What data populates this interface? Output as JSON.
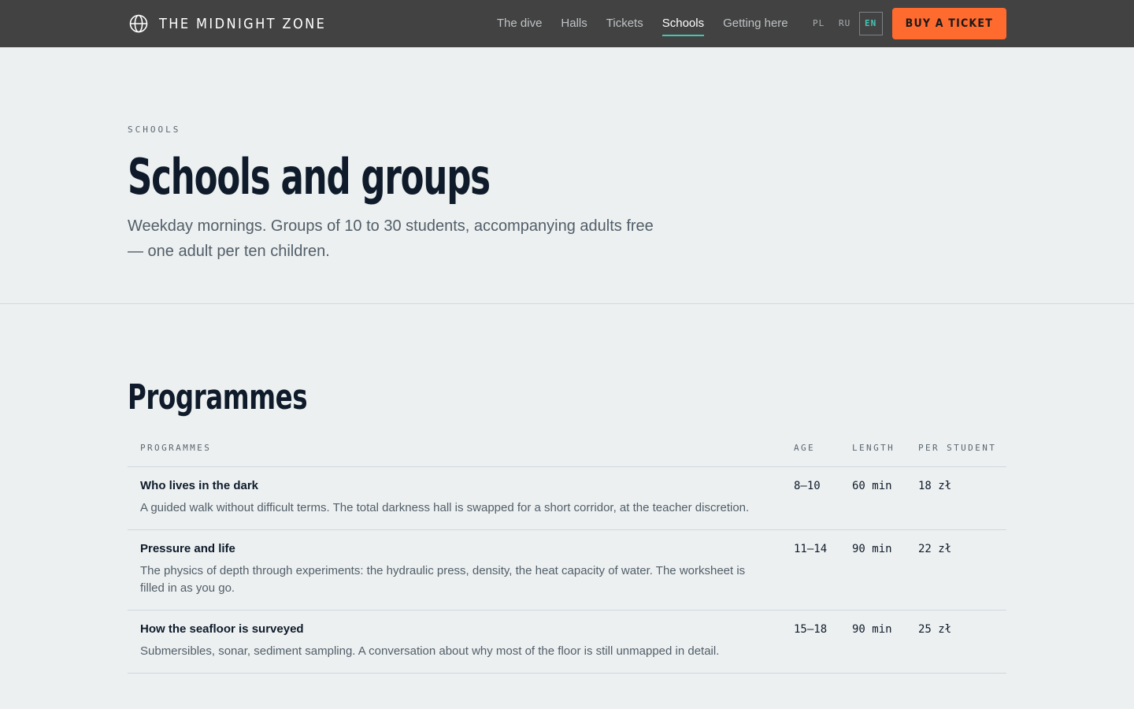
{
  "brand": {
    "name": "THE MIDNIGHT ZONE",
    "icon": "globe-icon"
  },
  "nav": {
    "items": [
      {
        "label": "The dive",
        "active": false
      },
      {
        "label": "Halls",
        "active": false
      },
      {
        "label": "Tickets",
        "active": false
      },
      {
        "label": "Schools",
        "active": true
      },
      {
        "label": "Getting here",
        "active": false
      }
    ],
    "languages": [
      {
        "code": "PL",
        "active": false
      },
      {
        "code": "RU",
        "active": false
      },
      {
        "code": "EN",
        "active": true
      }
    ],
    "cta_label": "BUY A TICKET"
  },
  "hero": {
    "eyebrow": "SCHOOLS",
    "title": "Schools and groups",
    "subtitle": "Weekday mornings. Groups of 10 to 30 students, accompanying adults free — one adult per ten children."
  },
  "programmes": {
    "title": "Programmes",
    "columns": {
      "programme": "PROGRAMMES",
      "age": "AGE",
      "length": "LENGTH",
      "price": "PER STUDENT"
    },
    "rows": [
      {
        "name": "Who lives in the dark",
        "description": "A guided walk without difficult terms. The total darkness hall is swapped for a short corridor, at the teacher discretion.",
        "age": "8–10",
        "length": "60 min",
        "price": "18 zł"
      },
      {
        "name": "Pressure and life",
        "description": "The physics of depth through experiments: the hydraulic press, density, the heat capacity of water. The worksheet is filled in as you go.",
        "age": "11–14",
        "length": "90 min",
        "price": "22 zł"
      },
      {
        "name": "How the seafloor is surveyed",
        "description": "Submersibles, sonar, sediment sampling. A conversation about why most of the floor is still unmapped in detail.",
        "age": "15–18",
        "length": "90 min",
        "price": "25 zł"
      }
    ]
  },
  "colors": {
    "header_bg": "#424242",
    "page_bg": "#ecf0f1",
    "accent": "#46c5b3",
    "cta": "#ff6a2e",
    "heading": "#0f1b2a",
    "body_text": "#525e68"
  }
}
